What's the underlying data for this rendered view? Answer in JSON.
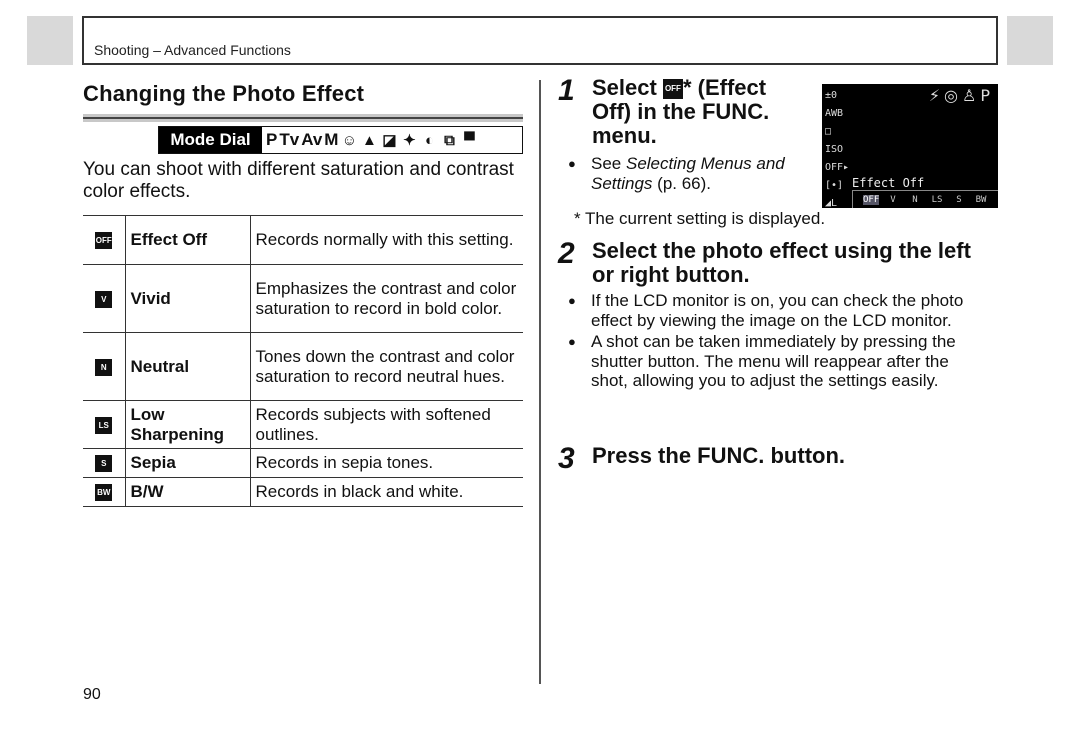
{
  "header": {
    "section": "Shooting – Advanced Functions"
  },
  "title": "Changing the Photo Effect",
  "mode_dial": {
    "label": "Mode Dial",
    "modes": [
      "P",
      "Tv",
      "Av",
      "M"
    ],
    "mode_icons": [
      "portrait-icon",
      "landscape-icon",
      "night-scene-icon",
      "sports-icon",
      "special-scene-icon",
      "stitch-assist-icon",
      "movie-icon"
    ]
  },
  "intro": "You can shoot with different saturation and contrast color effects.",
  "effects": [
    {
      "icon": "OFF",
      "icon_name": "effect-off-icon",
      "name": "Effect Off",
      "description": "Records normally with this setting."
    },
    {
      "icon": "V",
      "icon_name": "vivid-icon",
      "name": "Vivid",
      "description": "Emphasizes the contrast and color saturation to record in bold color."
    },
    {
      "icon": "N",
      "icon_name": "neutral-icon",
      "name": "Neutral",
      "description": "Tones down the contrast and color saturation to record neutral hues."
    },
    {
      "icon": "LS",
      "icon_name": "low-sharpening-icon",
      "name": "Low Sharpening",
      "description": "Records subjects with softened outlines."
    },
    {
      "icon": "S",
      "icon_name": "sepia-icon",
      "name": "Sepia",
      "description": "Records in sepia tones."
    },
    {
      "icon": "BW",
      "icon_name": "bw-icon",
      "name": "B/W",
      "description": "Records in black and white."
    }
  ],
  "steps": [
    {
      "number": "1",
      "title_pre": "Select ",
      "title_icon": "OFF",
      "title_post": "* (Effect Off) in the FUNC. menu.",
      "bullets": [
        {
          "pre": "See ",
          "italic": "Selecting Menus and Settings",
          "post": " (p. 66)."
        }
      ],
      "note": "* The current setting is displayed."
    },
    {
      "number": "2",
      "title": "Select the photo effect using the left or right button.",
      "bullets": [
        {
          "text": "If the LCD monitor is on, you can check the photo effect by viewing the image on the LCD monitor."
        },
        {
          "text": "A shot can be taken immediately by pressing the shutter button. The menu will reappear after the shot, allowing you to adjust the settings easily."
        }
      ]
    },
    {
      "number": "3",
      "title": "Press the FUNC. button."
    }
  ],
  "lcd": {
    "left_items": [
      "±0",
      "AWB",
      "□",
      "ISO",
      "OFF▸",
      "[•]",
      "◢L"
    ],
    "top_icons": "⚡◎♙P",
    "status": "Effect Off",
    "bar_items": [
      "OFF",
      "V",
      "N",
      "LS",
      "S",
      "BW"
    ],
    "selected": 0
  },
  "page_number": "90"
}
